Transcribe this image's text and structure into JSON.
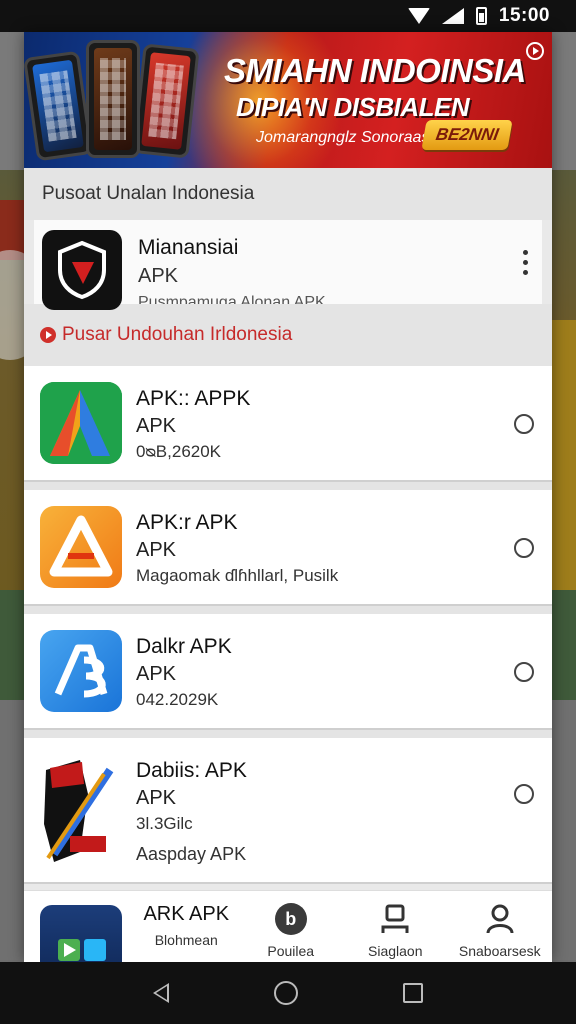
{
  "status_bar": {
    "time": "15:00"
  },
  "banner": {
    "title": "SMIAHN INDOINSIA",
    "subtitle": "DIPIA'N DISBIALEN",
    "tagline": "Jomarangnglz Sonoraasr",
    "button": "BE2NNI"
  },
  "section_title": "Pusoat Unalan Indonesia",
  "featured": {
    "name": "Mianansiai",
    "type": "APK",
    "meta": "Pusmpamuga Alonan APK"
  },
  "section_label": "Pusar Undouhan Irldonesia",
  "apps": [
    {
      "name": "APK:: APPK",
      "type": "APK",
      "meta": "0ᴓB,2620K",
      "extra": ""
    },
    {
      "name": "APK:r APK",
      "type": "APK",
      "meta": "Magaomak ɗlɦhllarl, Pusilk",
      "extra": ""
    },
    {
      "name": "Dalkr APK",
      "type": "APK",
      "meta": "042.2029K",
      "extra": ""
    },
    {
      "name": "Dabiis: APK",
      "type": "APK",
      "meta": "3l.3Ԍilc",
      "extra": "Aaspday APK"
    }
  ],
  "bottom_nav": {
    "first_top": "ARK APK",
    "items": [
      {
        "label": "Blohmean",
        "icon": "apk-icon"
      },
      {
        "label": "Pouilea",
        "icon": "b-circle-icon"
      },
      {
        "label": "Siaglaon",
        "icon": "person-flat-icon"
      },
      {
        "label": "Snaboarsesk",
        "icon": "person-icon"
      }
    ]
  },
  "colors": {
    "accent_red": "#c62a2a",
    "banner_red": "#d42020",
    "banner_blue": "#15409a"
  }
}
